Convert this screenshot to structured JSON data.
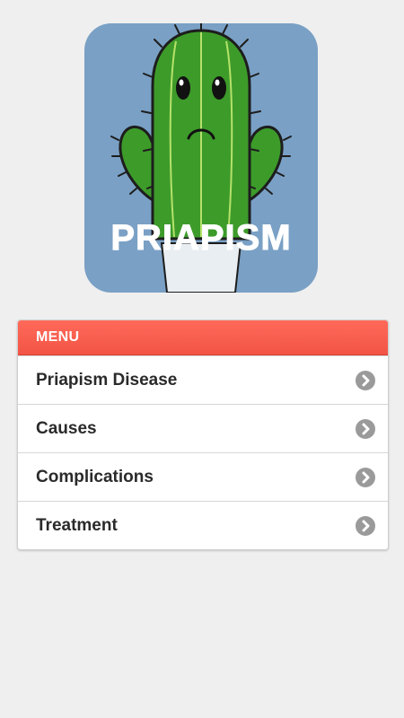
{
  "logo": {
    "text": "PRIAPISM",
    "background_color": "#7aa0c5",
    "icon": "cactus-icon"
  },
  "menu": {
    "header": "MENU",
    "header_color": "#f25445",
    "items": [
      {
        "label": "Priapism Disease",
        "icon": "chevron-right-icon"
      },
      {
        "label": "Causes",
        "icon": "chevron-right-icon"
      },
      {
        "label": "Complications",
        "icon": "chevron-right-icon"
      },
      {
        "label": "Treatment",
        "icon": "chevron-right-icon"
      }
    ]
  }
}
